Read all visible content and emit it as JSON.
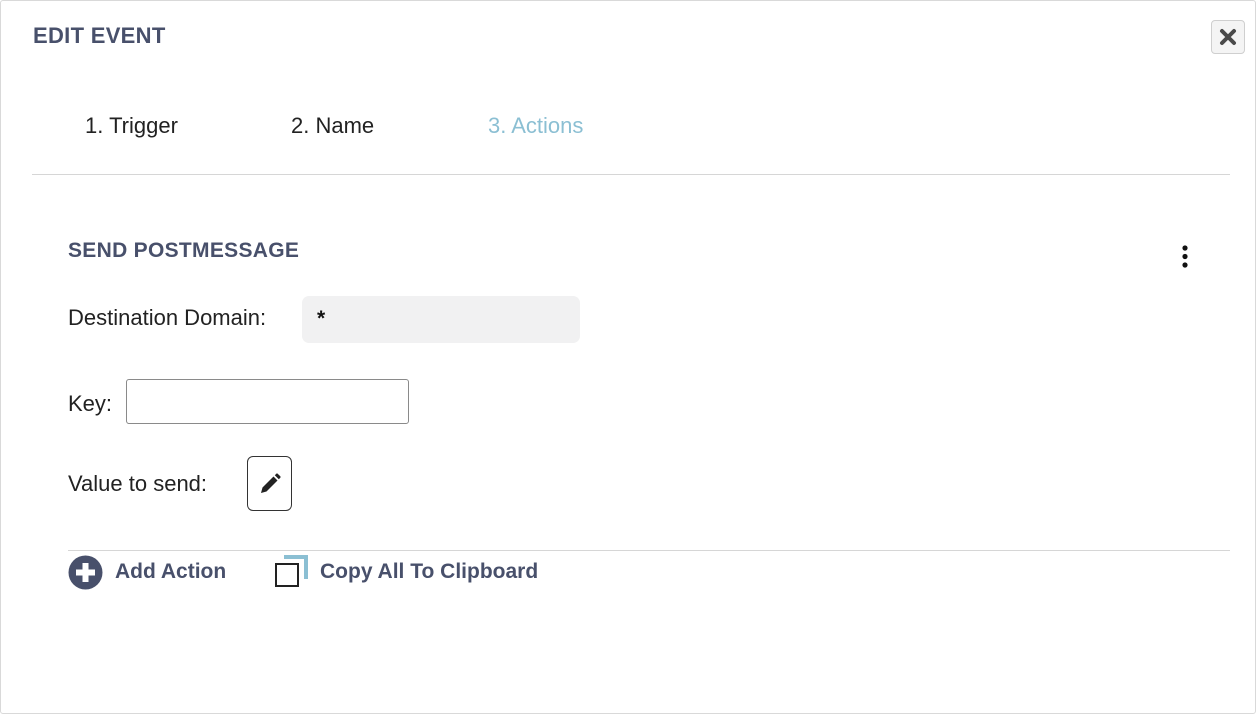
{
  "dialog": {
    "title": "EDIT EVENT",
    "close_icon": "close-x-icon"
  },
  "tabs": [
    {
      "label": "1. Trigger",
      "active": false
    },
    {
      "label": "2. Name",
      "active": false
    },
    {
      "label": "3. Actions",
      "active": true
    }
  ],
  "action": {
    "title": "SEND POSTMESSAGE",
    "menu_icon": "vertical-ellipsis-icon",
    "destination_domain_label": "Destination Domain:",
    "destination_domain_value": "*",
    "key_label": "Key:",
    "key_value": "",
    "value_label": "Value to send:",
    "value_edit_icon": "pencil-icon"
  },
  "footer": {
    "add_action_label": "Add Action",
    "add_action_icon": "plus-circle-icon",
    "copy_label": "Copy All To Clipboard",
    "copy_icon": "copy-icon"
  },
  "colors": {
    "heading": "#48506b",
    "active_tab": "#8bbfd3",
    "copy_accent": "#8bbfd3"
  }
}
